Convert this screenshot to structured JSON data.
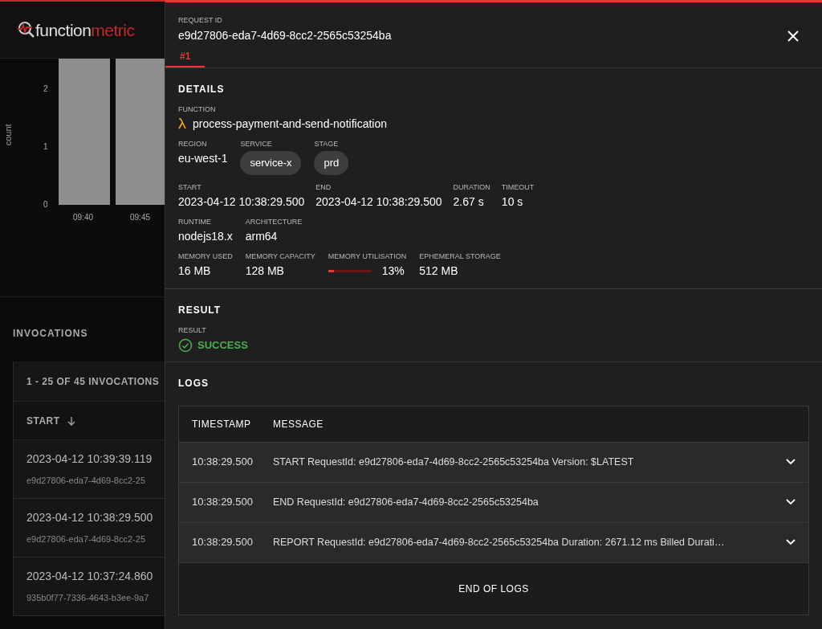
{
  "logo": {
    "first": "function",
    "second": "metric"
  },
  "chart": {
    "ylabel": "count",
    "yticks": [
      "2",
      "1",
      "0"
    ],
    "xticks": [
      "09:40",
      "09:45"
    ]
  },
  "invocations": {
    "title": "INVOCATIONS",
    "count": "1 - 25 OF 45 INVOCATIONS",
    "sort_column": "START",
    "rows": [
      {
        "start": "2023-04-12 10:39:39.119",
        "id": "e9d27806-eda7-4d69-8cc2-25"
      },
      {
        "start": "2023-04-12 10:38:29.500",
        "id": "e9d27806-eda7-4d69-8cc2-25"
      },
      {
        "start": "2023-04-12 10:37:24.860",
        "id": "935b0f77-7336-4643-b3ee-9a7"
      }
    ]
  },
  "drawer": {
    "request_label": "REQUEST ID",
    "request_id": "e9d27806-eda7-4d69-8cc2-2565c53254ba",
    "tabs": [
      {
        "label": "#1",
        "selected": true
      }
    ],
    "details": {
      "title": "DETAILS",
      "function_label": "FUNCTION",
      "function": "process-payment-and-send-notification",
      "lines": [
        {
          "fields": [
            {
              "label": "REGION",
              "value": "eu-west-1",
              "kind": "text"
            },
            {
              "label": "SERVICE",
              "value": "service-x",
              "kind": "chip"
            },
            {
              "label": "STAGE",
              "value": "prd",
              "kind": "chip"
            }
          ]
        },
        {
          "fields": [
            {
              "label": "START",
              "value": "2023-04-12 10:38:29.500",
              "kind": "text"
            },
            {
              "label": "END",
              "value": "2023-04-12 10:38:29.500",
              "kind": "text"
            },
            {
              "label": "DURATION",
              "value": "2.67 s",
              "kind": "text"
            },
            {
              "label": "TIMEOUT",
              "value": "10 s",
              "kind": "text"
            }
          ]
        },
        {
          "fields": [
            {
              "label": "RUNTIME",
              "value": "nodejs18.x",
              "kind": "text"
            },
            {
              "label": "ARCHITECTURE",
              "value": "arm64",
              "kind": "text"
            }
          ]
        },
        {
          "fields": [
            {
              "label": "MEMORY USED",
              "value": "16 MB",
              "kind": "text"
            },
            {
              "label": "MEMORY CAPACITY",
              "value": "128 MB",
              "kind": "text"
            },
            {
              "label": "MEMORY UTILISATION",
              "value": "13%",
              "kind": "meter",
              "level": 0.13
            },
            {
              "label": "EPHEMERAL STORAGE",
              "value": "512 MB",
              "kind": "text"
            }
          ]
        }
      ]
    },
    "result": {
      "title": "RESULT",
      "label": "RESULT",
      "value": "SUCCESS",
      "kind": "success"
    },
    "logs": {
      "title": "LOGS",
      "columns": [
        "TIMESTAMP",
        "MESSAGE"
      ],
      "rows": [
        {
          "timestamp": "10:38:29.500",
          "message": "START RequestId: e9d27806-eda7-4d69-8cc2-2565c53254ba Version: $LATEST",
          "expanded": false
        },
        {
          "timestamp": "10:38:29.500",
          "message": "END RequestId: e9d27806-eda7-4d69-8cc2-2565c53254ba",
          "expanded": false
        },
        {
          "timestamp": "10:38:29.500",
          "message": "REPORT RequestId: e9d27806-eda7-4d69-8cc2-2565c53254ba Duration: 2671.12 ms Billed Durati…",
          "expanded": false
        }
      ],
      "footer": "END OF LOGS"
    }
  }
}
